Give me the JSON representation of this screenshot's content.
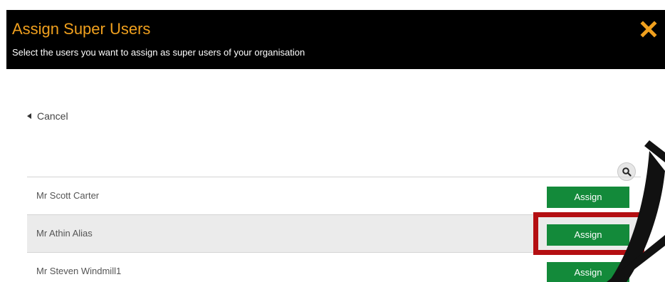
{
  "header": {
    "title": "Assign Super Users",
    "subtitle": "Select the users you want to assign as super users of your organisation"
  },
  "nav": {
    "cancel_label": "Cancel"
  },
  "users": [
    {
      "name": "Mr Scott Carter",
      "action_label": "Assign"
    },
    {
      "name": "Mr Athin Alias",
      "action_label": "Assign"
    },
    {
      "name": "Mr Steven Windmill1",
      "action_label": "Assign"
    }
  ],
  "colors": {
    "header_bg": "#000000",
    "title": "#f0a01e",
    "close_icon": "#f0a01e",
    "assign_button": "#138a3a",
    "highlight_box": "#b40f12",
    "highlight_row": "#ebebeb"
  },
  "icons": {
    "close": "close-icon",
    "search": "search-icon",
    "back": "caret-left-icon"
  }
}
